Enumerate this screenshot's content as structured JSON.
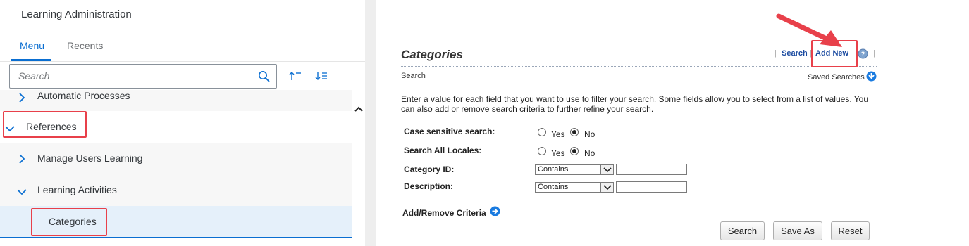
{
  "app": {
    "title": "Learning Administration"
  },
  "tabs": [
    {
      "label": "Menu",
      "active": true
    },
    {
      "label": "Recents",
      "active": false
    }
  ],
  "search": {
    "placeholder": "Search",
    "value": ""
  },
  "nav": {
    "items": [
      {
        "label": "Automatic Processes",
        "expanded": false
      },
      {
        "label": "References",
        "expanded": true
      },
      {
        "label": "Manage Users Learning",
        "expanded": false
      },
      {
        "label": "Learning Activities",
        "expanded": true
      },
      {
        "label": "Categories",
        "selected": true
      }
    ]
  },
  "page": {
    "title": "Categories",
    "toolbar": {
      "search_label": "Search",
      "add_new_label": "Add New"
    },
    "section_label": "Search",
    "saved_searches_label": "Saved Searches",
    "intro": "Enter a value for each field that you want to use to filter your search. Some fields allow you to select from a list of values. You can also add or remove search criteria to further refine your search.",
    "fields": {
      "case_sensitive": {
        "label": "Case sensitive search:",
        "yes": "Yes",
        "no": "No",
        "selected": "No"
      },
      "all_locales": {
        "label": "Search All Locales:",
        "yes": "Yes",
        "no": "No",
        "selected": "No"
      },
      "category_id": {
        "label": "Category ID:",
        "operator": "Contains",
        "value": ""
      },
      "description": {
        "label": "Description:",
        "operator": "Contains",
        "value": ""
      }
    },
    "add_remove_label": "Add/Remove Criteria",
    "buttons": {
      "search": "Search",
      "save_as": "Save As",
      "reset": "Reset"
    }
  },
  "colors": {
    "accent": "#0a6ed1",
    "highlight": "#e8404a",
    "link": "#1a4aa0"
  }
}
